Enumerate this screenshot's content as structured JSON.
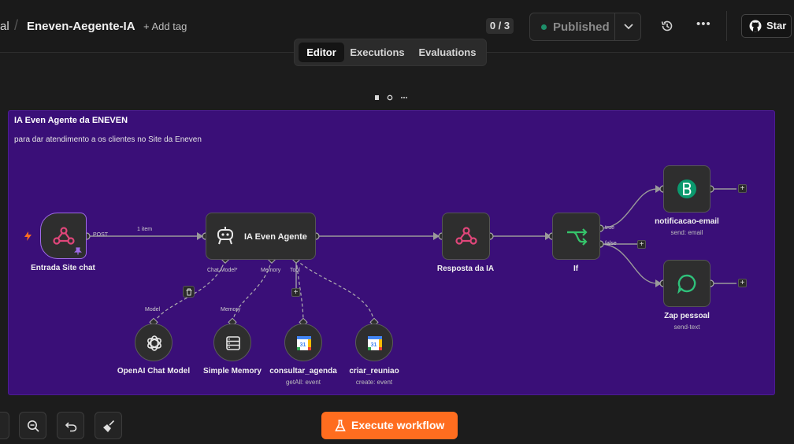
{
  "header": {
    "breadcrumb_prefix": "al",
    "workflow_name": "Eneven-Aegente-IA",
    "add_tag": "+ Add tag",
    "counter": "0 / 3",
    "publish_label": "Published",
    "star_label": "Star"
  },
  "tabs": [
    "Editor",
    "Executions",
    "Evaluations"
  ],
  "sticky": {
    "title": "IA Even Agente da ENEVEN",
    "description": "para dar atendimento a os clientes no Site da Eneven"
  },
  "nodes": {
    "trigger": {
      "label": "Entrada Site chat",
      "port_label": "POST"
    },
    "edge_label": "1 item",
    "agent": {
      "label": "IA Even Agente",
      "port_chat": "Chat Model*",
      "port_memory": "Memory",
      "port_tool": "Tool"
    },
    "response": {
      "label": "Resposta da IA"
    },
    "if": {
      "label": "If",
      "true_label": "true",
      "false_label": "false"
    },
    "email": {
      "label": "notificacao-email",
      "sub": "send: email"
    },
    "zap": {
      "label": "Zap pessoal",
      "sub": "send-text"
    },
    "openai": {
      "label": "OpenAI Chat Model",
      "port_label": "Model"
    },
    "memory": {
      "label": "Simple Memory",
      "port_label": "Memory"
    },
    "consultar": {
      "label": "consultar_agenda",
      "sub": "getAll: event"
    },
    "criar": {
      "label": "criar_reuniao",
      "sub": "create: event"
    }
  },
  "execute_label": "Execute workflow",
  "colors": {
    "sticky": "#3a0f78",
    "accent_orange": "#ff6d1f",
    "webhook_pink": "#e0467a",
    "if_green": "#35c46a",
    "published_dot": "#1e8f6a"
  }
}
